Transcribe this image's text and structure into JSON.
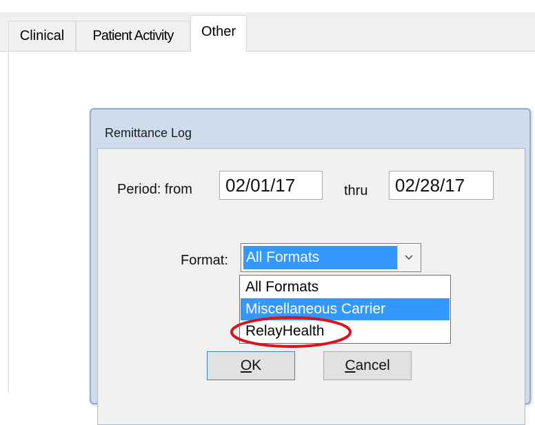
{
  "tabs": [
    {
      "label": "Clinical"
    },
    {
      "label": "Patient Activity"
    },
    {
      "label": "Other"
    }
  ],
  "dialog": {
    "title": "Remittance Log",
    "period_label": "Period:  from",
    "from_date": "02/01/17",
    "thru_label": "thru",
    "thru_date": "02/28/17",
    "format_label": "Format:",
    "format_selected": "All Formats",
    "format_options": [
      "All Formats",
      "Miscellaneous Carrier",
      "RelayHealth"
    ],
    "highlighted_option": "Miscellaneous Carrier",
    "ok_label_mnemonic": "O",
    "ok_label_rest": "K",
    "cancel_label_mnemonic": "C",
    "cancel_label_rest": "ancel"
  },
  "annotation": {
    "color": "#d9141e",
    "target": "RelayHealth"
  },
  "colors": {
    "selection": "#3399ff",
    "dialog_frame": "#cfdcec",
    "tab_bg": "#f0f0f0"
  },
  "icons": {
    "combo_arrow": "chevron-down-icon"
  }
}
